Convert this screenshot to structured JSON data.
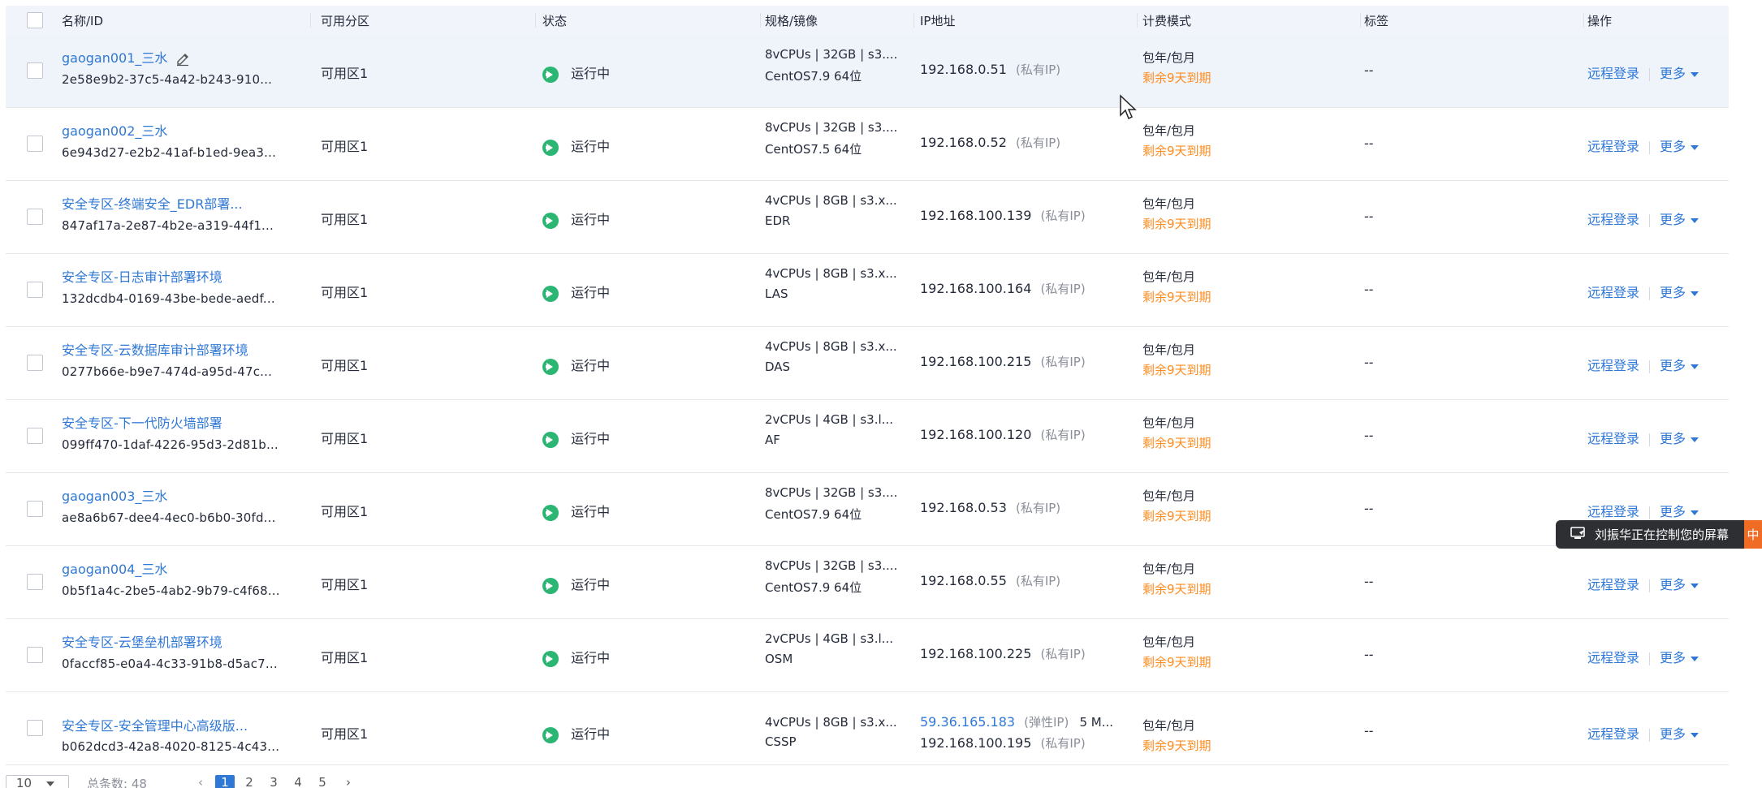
{
  "columns": [
    "名称/ID",
    "可用分区",
    "状态",
    "规格/镜像",
    "IP地址",
    "计费模式",
    "标签",
    "操作"
  ],
  "rows": [
    {
      "name": "gaogan001_三水",
      "id": "2e58e9b2-37c5-4a42-b243-910...",
      "zone": "可用区1",
      "status": "运行中",
      "spec": "8vCPUs | 32GB | s3....",
      "image": "CentOS7.9 64位",
      "ip1": "192.168.0.51",
      "ip1_type": "(私有IP)",
      "ip2": "",
      "ip2_type": "",
      "billing": "包年/包月",
      "expire": "剩余9天到期",
      "tag": "--",
      "op_login": "远程登录",
      "op_more": "更多",
      "editable": true,
      "highlight": true
    },
    {
      "name": "gaogan002_三水",
      "id": "6e943d27-e2b2-41af-b1ed-9ea3...",
      "zone": "可用区1",
      "status": "运行中",
      "spec": "8vCPUs | 32GB | s3....",
      "image": "CentOS7.5 64位",
      "ip1": "192.168.0.52",
      "ip1_type": "(私有IP)",
      "ip2": "",
      "ip2_type": "",
      "billing": "包年/包月",
      "expire": "剩余9天到期",
      "tag": "--",
      "op_login": "远程登录",
      "op_more": "更多"
    },
    {
      "name": "安全专区-终端安全_EDR部署...",
      "id": "847af17a-2e87-4b2e-a319-44f1...",
      "zone": "可用区1",
      "status": "运行中",
      "spec": "4vCPUs | 8GB | s3.x...",
      "image": "EDR",
      "ip1": "192.168.100.139",
      "ip1_type": "(私有IP)",
      "ip2": "",
      "ip2_type": "",
      "billing": "包年/包月",
      "expire": "剩余9天到期",
      "tag": "--",
      "op_login": "远程登录",
      "op_more": "更多"
    },
    {
      "name": "安全专区-日志审计部署环境",
      "id": "132dcdb4-0169-43be-bede-aedf...",
      "zone": "可用区1",
      "status": "运行中",
      "spec": "4vCPUs | 8GB | s3.x...",
      "image": "LAS",
      "ip1": "192.168.100.164",
      "ip1_type": "(私有IP)",
      "ip2": "",
      "ip2_type": "",
      "billing": "包年/包月",
      "expire": "剩余9天到期",
      "tag": "--",
      "op_login": "远程登录",
      "op_more": "更多"
    },
    {
      "name": "安全专区-云数据库审计部署环境",
      "id": "0277b66e-b9e7-474d-a95d-47c...",
      "zone": "可用区1",
      "status": "运行中",
      "spec": "4vCPUs | 8GB | s3.x...",
      "image": "DAS",
      "ip1": "192.168.100.215",
      "ip1_type": "(私有IP)",
      "ip2": "",
      "ip2_type": "",
      "billing": "包年/包月",
      "expire": "剩余9天到期",
      "tag": "--",
      "op_login": "远程登录",
      "op_more": "更多"
    },
    {
      "name": "安全专区-下一代防火墙部署",
      "id": "099ff470-1daf-4226-95d3-2d81b...",
      "zone": "可用区1",
      "status": "运行中",
      "spec": "2vCPUs | 4GB | s3.l...",
      "image": "AF",
      "ip1": "192.168.100.120",
      "ip1_type": "(私有IP)",
      "ip2": "",
      "ip2_type": "",
      "billing": "包年/包月",
      "expire": "剩余9天到期",
      "tag": "--",
      "op_login": "远程登录",
      "op_more": "更多"
    },
    {
      "name": "gaogan003_三水",
      "id": "ae8a6b67-dee4-4ec0-b6b0-30fd...",
      "zone": "可用区1",
      "status": "运行中",
      "spec": "8vCPUs | 32GB | s3....",
      "image": "CentOS7.9 64位",
      "ip1": "192.168.0.53",
      "ip1_type": "(私有IP)",
      "ip2": "",
      "ip2_type": "",
      "billing": "包年/包月",
      "expire": "剩余9天到期",
      "tag": "--",
      "op_login": "远程登录",
      "op_more": "更多"
    },
    {
      "name": "gaogan004_三水",
      "id": "0b5f1a4c-2be5-4ab2-9b79-c4f68...",
      "zone": "可用区1",
      "status": "运行中",
      "spec": "8vCPUs | 32GB | s3....",
      "image": "CentOS7.9 64位",
      "ip1": "192.168.0.55",
      "ip1_type": "(私有IP)",
      "ip2": "",
      "ip2_type": "",
      "billing": "包年/包月",
      "expire": "剩余9天到期",
      "tag": "--",
      "op_login": "远程登录",
      "op_more": "更多"
    },
    {
      "name": "安全专区-云堡垒机部署环境",
      "id": "0faccf85-e0a4-4c33-91b8-d5ac7...",
      "zone": "可用区1",
      "status": "运行中",
      "spec": "2vCPUs | 4GB | s3.l...",
      "image": "OSM",
      "ip1": "192.168.100.225",
      "ip1_type": "(私有IP)",
      "ip2": "",
      "ip2_type": "",
      "billing": "包年/包月",
      "expire": "剩余9天到期",
      "tag": "--",
      "op_login": "远程登录",
      "op_more": "更多"
    },
    {
      "name": "安全专区-安全管理中心高级版...",
      "id": "b062dcd3-42a8-4020-8125-4c43...",
      "zone": "可用区1",
      "status": "运行中",
      "spec": "4vCPUs | 8GB | s3.x...",
      "image": "CSSP",
      "ip1": "59.36.165.183",
      "ip1_type": "(弹性IP)",
      "ip1_extra": "5 M...",
      "ip2": "192.168.100.195",
      "ip2_type": "(私有IP)",
      "billing": "包年/包月",
      "expire": "剩余9天到期",
      "tag": "--",
      "op_login": "远程登录",
      "op_more": "更多",
      "eip": true
    }
  ],
  "toast": {
    "text": "刘振华正在控制您的屏幕",
    "tag": "中"
  },
  "pager": {
    "page_size": "10",
    "total": "总条数: 48",
    "pages": [
      "1",
      "2",
      "3",
      "4",
      "5"
    ],
    "current": "1"
  }
}
